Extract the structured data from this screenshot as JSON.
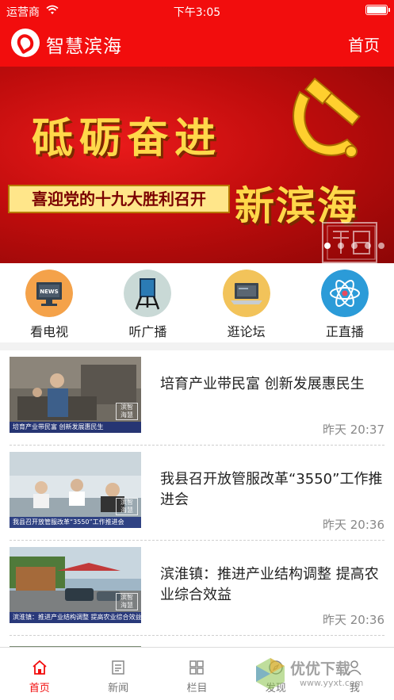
{
  "status_bar": {
    "carrier": "运营商",
    "time": "下午3:05"
  },
  "nav_bar": {
    "title": "智慧滨海",
    "home_link": "首页"
  },
  "banner": {
    "headline": "砥砺奋进",
    "subline": "喜迎党的十九大胜利召开",
    "big_name": "新滨海",
    "seal_text": "滨智海慧",
    "slide_count": 5,
    "active_slide": 1
  },
  "quick_nav": [
    {
      "label": "看电视",
      "icon": "tv-news-icon",
      "icon_text": "NEWS"
    },
    {
      "label": "听广播",
      "icon": "radio-easel-icon"
    },
    {
      "label": "逛论坛",
      "icon": "laptop-icon"
    },
    {
      "label": "正直播",
      "icon": "atom-icon"
    }
  ],
  "news": [
    {
      "title": "培育产业带民富 创新发展惠民生",
      "time": "昨天 20:37",
      "caption": "培育产业带民富 创新发展惠民生"
    },
    {
      "title": "我县召开放管服改革“3550”工作推进会",
      "time": "昨天 20:36",
      "caption": "我县召开放管服改革“3550”工作推进会"
    },
    {
      "title": "滨淮镇：推进产业结构调整 提高农业综合效益",
      "time": "昨天 20:36",
      "caption": "滨淮镇：推进产业结构调整 提高农业综合效益"
    }
  ],
  "tab_bar": [
    {
      "label": "首页",
      "icon": "home-icon",
      "active": true
    },
    {
      "label": "新闻",
      "icon": "news-icon",
      "active": false
    },
    {
      "label": "栏目",
      "icon": "grid-icon",
      "active": false
    },
    {
      "label": "发现",
      "icon": "compass-icon",
      "active": false
    },
    {
      "label": "我",
      "icon": "person-icon",
      "active": false
    }
  ],
  "watermark": {
    "text": "优优下载",
    "url": "www.yyxt.com"
  },
  "colors": {
    "brand_red": "#f20d0d",
    "banner_gold": "#ffd84a",
    "tab_inactive": "#777777"
  }
}
